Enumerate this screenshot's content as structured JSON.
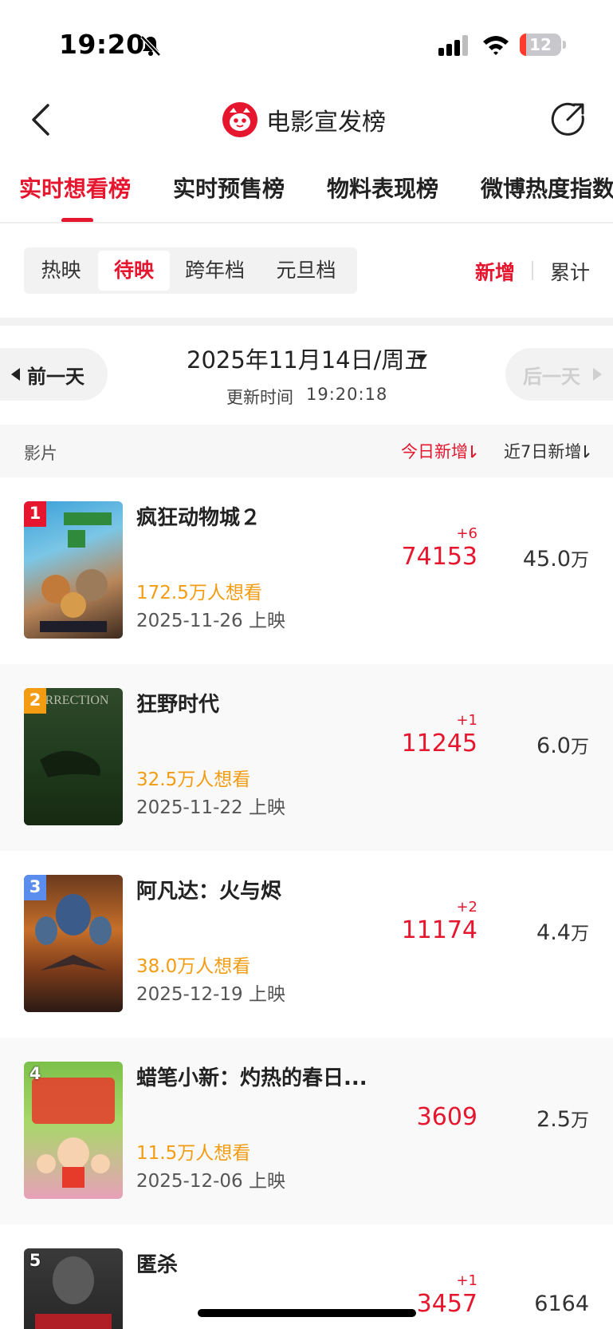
{
  "status_bar": {
    "time": "19:20",
    "battery": "12"
  },
  "header": {
    "title": "电影宣发榜"
  },
  "tabs": [
    {
      "label": "实时想看榜"
    },
    {
      "label": "实时预售榜"
    },
    {
      "label": "物料表现榜"
    },
    {
      "label": "微博热度指数"
    }
  ],
  "segments": [
    {
      "label": "热映"
    },
    {
      "label": "待映"
    },
    {
      "label": "跨年档"
    },
    {
      "label": "元旦档"
    }
  ],
  "toggle": {
    "new": "新增",
    "total": "累计"
  },
  "date_nav": {
    "prev": "前一天",
    "date": "2025年11月14日/周五",
    "update_label": "更新时间",
    "update_time": "19:20:18",
    "next": "后一天"
  },
  "columns": {
    "film": "影片",
    "today": "今日新增",
    "week": "近7日新增"
  },
  "films": [
    {
      "rank": "1",
      "name": "疯狂动物城２",
      "want": "172.5万人想看",
      "release": "2025-11-26 上映",
      "delta": "+6",
      "today": "74153",
      "week": "45.0",
      "week_unit": "万"
    },
    {
      "rank": "2",
      "name": "狂野时代",
      "want": "32.5万人想看",
      "release": "2025-11-22 上映",
      "delta": "+1",
      "today": "11245",
      "week": "6.0",
      "week_unit": "万"
    },
    {
      "rank": "3",
      "name": "阿凡达：火与烬",
      "want": "38.0万人想看",
      "release": "2025-12-19 上映",
      "delta": "+2",
      "today": "11174",
      "week": "4.4",
      "week_unit": "万"
    },
    {
      "rank": "4",
      "name": "蜡笔小新：灼热的春日...",
      "want": "11.5万人想看",
      "release": "2025-12-06 上映",
      "delta": "",
      "today": "3609",
      "week": "2.5",
      "week_unit": "万"
    },
    {
      "rank": "5",
      "name": "匿杀",
      "want": "",
      "release": "",
      "delta": "+1",
      "today": "3457",
      "week": "6164",
      "week_unit": ""
    }
  ],
  "colors": {
    "accent": "#e5162e",
    "orange": "#f39c12",
    "rank3": "#5b8def"
  }
}
